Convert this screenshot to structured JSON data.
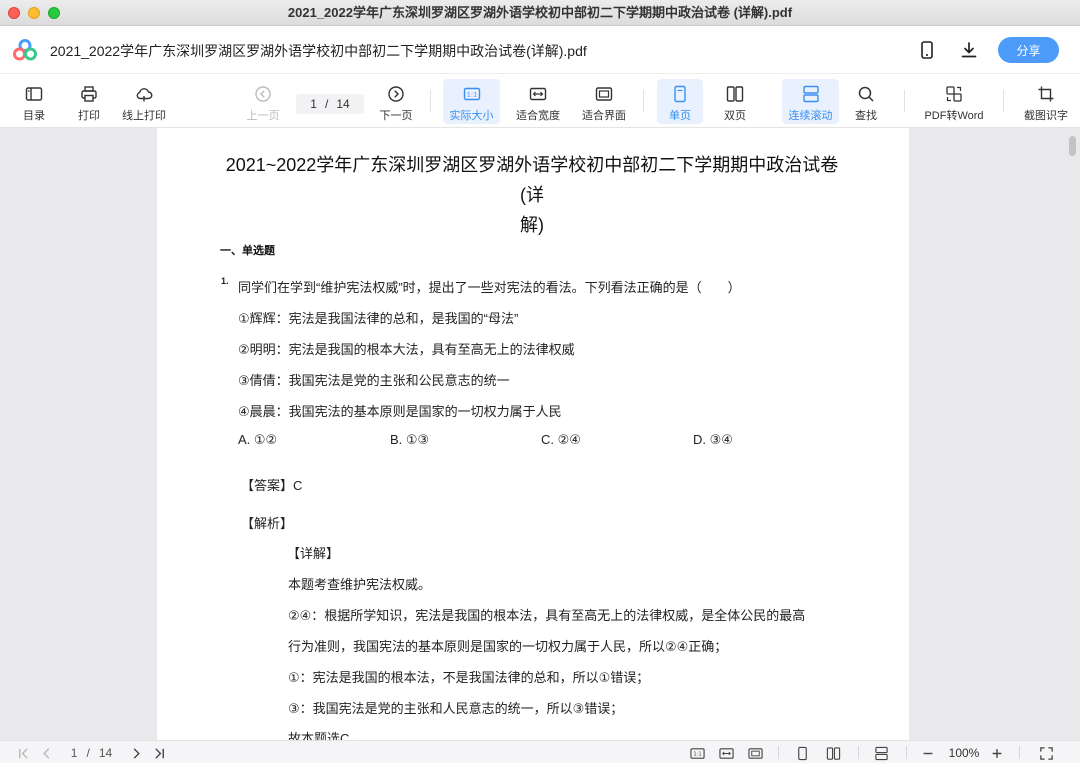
{
  "window": {
    "title": "2021_2022学年广东深圳罗湖区罗湖外语学校初中部初二下学期期中政治试卷 (详解).pdf"
  },
  "header": {
    "doc_name": "2021_2022学年广东深圳罗湖区罗湖外语学校初中部初二下学期期中政治试卷(详解).pdf",
    "share_label": "分享"
  },
  "toolbar": {
    "toc": "目录",
    "print": "打印",
    "online_print": "线上打印",
    "prev": "上一页",
    "next": "下一页",
    "current_page": "1",
    "page_sep": "/",
    "total_pages": "14",
    "actual_size": "实际大小",
    "fit_width": "适合宽度",
    "fit_page": "适合界面",
    "single_page": "单页",
    "double_page": "双页",
    "continuous": "连续滚动",
    "find": "查找",
    "pdf_to_word": "PDF转Word",
    "ocr": "截图识字"
  },
  "document": {
    "title_line1": "2021~2022学年广东深圳罗湖区罗湖外语学校初中部初二下学期期中政治试卷(详",
    "title_line2": "解)",
    "section": "一、单选题",
    "q_number": "1.",
    "question": "同学们在学到“维护宪法权威”时，提出了一些对宪法的看法。下列看法正确的是（　　）",
    "statements": [
      "①辉辉：宪法是我国法律的总和，是我国的“母法”",
      "②明明：宪法是我国的根本大法，具有至高无上的法律权威",
      "③倩倩：我国宪法是党的主张和公民意志的统一",
      "④晨晨：我国宪法的基本原则是国家的一切权力属于人民"
    ],
    "options": [
      "A. ①②",
      "B. ①③",
      "C. ②④",
      "D. ③④"
    ],
    "answer_label": "【答案】",
    "answer": "C",
    "analysis_label": "【解析】",
    "detail_label": "【详解】",
    "detail_lines": [
      "本题考查维护宪法权威。",
      "②④：根据所学知识，宪法是我国的根本法，具有至高无上的法律权威，是全体公民的最高",
      "行为准则，我国宪法的基本原则是国家的一切权力属于人民，所以②④正确；",
      "①：宪法是我国的根本法，不是我国法律的总和，所以①错误；",
      "③：我国宪法是党的主张和人民意志的统一，所以③错误；",
      "故本题选C。"
    ]
  },
  "statusbar": {
    "current_page": "1",
    "page_sep": "/",
    "total_pages": "14",
    "zoom": "100%"
  },
  "colors": {
    "accent": "#4c9bf8",
    "active_bg": "#e8f1fd"
  }
}
